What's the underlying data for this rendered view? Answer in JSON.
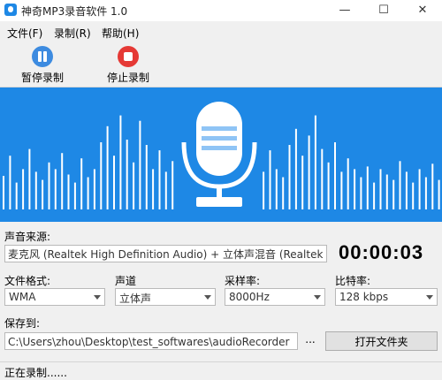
{
  "window": {
    "title": "神奇MP3录音软件 1.0"
  },
  "menu": {
    "items": [
      "文件(F)",
      "录制(R)",
      "帮助(H)"
    ]
  },
  "toolbar": {
    "pause_label": "暂停录制",
    "stop_label": "停止录制"
  },
  "form": {
    "source_label": "声音来源:",
    "source_value": "麦克风 (Realtek High Definition Audio) + 立体声混音 (Realtek Hig ...",
    "timer": "00:00:03",
    "format_label": "文件格式:",
    "format_value": "WMA",
    "channel_label": "声道",
    "channel_value": "立体声",
    "samplerate_label": "采样率:",
    "samplerate_value": "8000Hz",
    "bitrate_label": "比特率:",
    "bitrate_value": "128 kbps",
    "save_label": "保存到:",
    "save_path": "C:\\Users\\zhou\\Desktop\\test_softwares\\audioRecorder",
    "open_folder_label": "打开文件夹",
    "browse_label": "..."
  },
  "status": {
    "text": "正在录制......"
  },
  "visualizer": {
    "bar_heights": [
      0.25,
      0.4,
      0.2,
      0.3,
      0.45,
      0.28,
      0.22,
      0.35,
      0.3,
      0.42,
      0.26,
      0.2,
      0.38,
      0.24,
      0.3,
      0.5,
      0.62,
      0.4,
      0.7,
      0.52,
      0.35,
      0.66,
      0.48,
      0.3,
      0.44,
      0.28,
      0.36,
      0.22,
      0.3,
      0.26,
      0.4,
      0.2,
      0.34,
      0.24,
      0.3,
      0.2,
      0.26,
      0.3,
      0.22,
      0.36,
      0.28,
      0.44,
      0.3,
      0.24,
      0.48,
      0.6,
      0.4,
      0.55,
      0.7,
      0.45,
      0.35,
      0.5,
      0.28,
      0.38,
      0.3,
      0.24,
      0.32,
      0.2,
      0.3,
      0.26,
      0.22,
      0.36,
      0.28,
      0.2,
      0.3,
      0.24,
      0.34,
      0.22
    ],
    "color": "#1e88e5"
  }
}
